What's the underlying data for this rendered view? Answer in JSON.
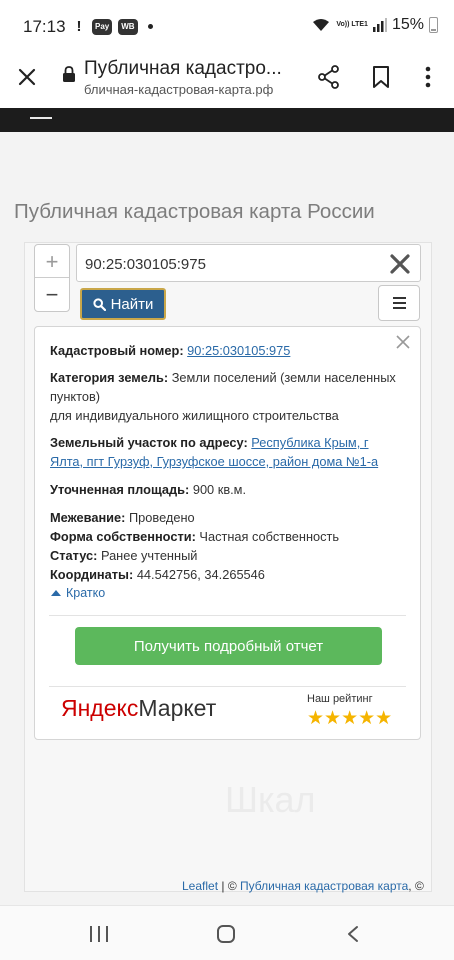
{
  "status_bar": {
    "time": "17:13",
    "notif_pay": "Pay",
    "notif_wb": "WB",
    "network": "Vo)) LTE1",
    "battery": "15%"
  },
  "browser": {
    "title": "Публичная кадастро...",
    "url": "бличная-кадастровая-карта.рф"
  },
  "page": {
    "heading": "Публичная кадастровая карта России"
  },
  "map": {
    "zoom_in": "+",
    "zoom_out": "−",
    "search_value": "90:25:030105:975",
    "find_label": "Найти",
    "watermark": "Шкал"
  },
  "popup": {
    "cadastral_label": "Кадастровый номер:",
    "cadastral_value": "90:25:030105:975",
    "category_label": "Категория земель:",
    "category_value": "Земли поселений (земли населенных пунктов)",
    "usage_value": "для индивидуального жилищного строительства",
    "address_label": "Земельный участок по адресу:",
    "address_value": "Республика Крым, г Ялта, пгт Гурзуф, Гурзуфское шоссе, район дома №1-а",
    "area_label": "Уточненная площадь:",
    "area_value": "900 кв.м.",
    "survey_label": "Межевание:",
    "survey_value": "Проведено",
    "ownership_label": "Форма собственности:",
    "ownership_value": "Частная собственность",
    "status_label": "Статус:",
    "status_value": "Ранее учтенный",
    "coords_label": "Координаты:",
    "coords_value": "44.542756, 34.265546",
    "brief_link": "Кратко",
    "report_button": "Получить подробный отчет",
    "ym_logo_ya": "Яндекс",
    "ym_logo_market": "Маркет",
    "rating_label": "Наш рейтинг",
    "rating_stars": "★★★★★",
    "rating_value": 5
  },
  "attribution": {
    "leaflet": "Leaflet",
    "separator": " | © ",
    "owner": "Публичная кадастровая карта",
    "suffix": ", ©"
  },
  "colors": {
    "accent_link": "#2a6aa8",
    "find_button": "#2c5f8e",
    "report_button": "#5cb85c",
    "stars": "#f5b400",
    "site_bar": "#1c1c1c"
  },
  "icons": [
    "close-icon",
    "lock-icon",
    "share-icon",
    "bookmark-icon",
    "more-vert-icon",
    "hamburger-icon",
    "clear-x-icon",
    "search-icon",
    "layers-icon",
    "popup-close-icon",
    "triangle-up-icon",
    "nav-recents-icon",
    "nav-home-icon",
    "nav-back-icon"
  ]
}
